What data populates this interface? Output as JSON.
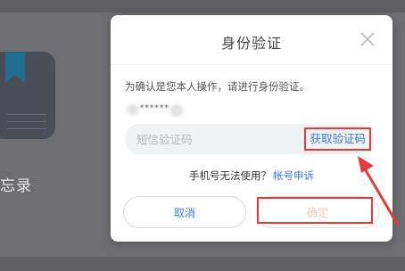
{
  "background": {
    "app_label": "忘录"
  },
  "dialog": {
    "title": "身份验证",
    "close_icon": "close-x",
    "instruction": "为确认是您本人操作，请进行身份验证。",
    "phone_masked": "******",
    "code_input": {
      "placeholder": "短信验证码",
      "value": ""
    },
    "get_code_label": "获取验证码",
    "help_text": "手机号无法使用？",
    "help_link": "帐号申诉",
    "cancel_label": "取消",
    "confirm_label": "确定"
  },
  "colors": {
    "accent": "#3b7dd8",
    "annotation_red": "#e23b3b",
    "confirm_disabled": "#f5c4c4"
  }
}
